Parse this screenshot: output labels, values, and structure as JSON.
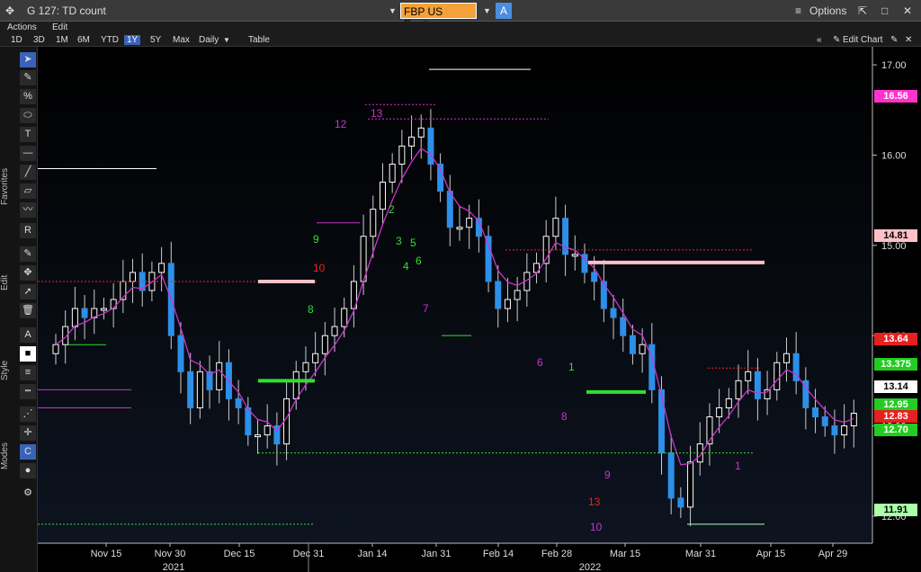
{
  "window": {
    "title": "G 127: TD count",
    "ticker": "FBP US Equity",
    "ticker_btn": "A",
    "options": "Options"
  },
  "menu": {
    "actions": "Actions",
    "edit": "Edit"
  },
  "periods": [
    "1D",
    "3D",
    "1M",
    "6M",
    "YTD",
    "1Y",
    "5Y",
    "Max"
  ],
  "period_selected": "1Y",
  "frequency": "Daily",
  "table": "Table",
  "edit_chart": "Edit Chart",
  "toolbar_sections": [
    "Favorites",
    "Edit",
    "Style",
    "Modes"
  ],
  "colors": {
    "up": "#ffffff",
    "down": "#2d8fe8",
    "td_green": "#33dd33",
    "td_magenta": "#cc33cc",
    "td_red": "#ee2222"
  },
  "chart_data": {
    "type": "candlestick",
    "ylim": [
      11.7,
      17.2
    ],
    "y_ticks": [
      "17.00",
      "16.00",
      "15.00",
      "14.00",
      "13.00",
      "12.00"
    ],
    "x_ticks": [
      "Nov 15",
      "Nov 30",
      "Dec 15",
      "Dec 31",
      "Jan 14",
      "Jan 31",
      "Feb 14",
      "Feb 28",
      "Mar 15",
      "Mar 31",
      "Apr 15",
      "Apr 29"
    ],
    "year_labels": [
      "2021",
      "2022"
    ],
    "price_labels": [
      {
        "value": "16.56",
        "color": "#ff33cc"
      },
      {
        "value": "14.81",
        "color": "#ffc0c8"
      },
      {
        "value": "13.64",
        "color": "#e62020"
      },
      {
        "value": "13.375",
        "color": "#22cc22"
      },
      {
        "value": "13.14",
        "color": "#ffffff"
      },
      {
        "value": "12.95",
        "color": "#22cc22"
      },
      {
        "value": "12.83",
        "color": "#e62020"
      },
      {
        "value": "12.70",
        "color": "#22cc22"
      },
      {
        "value": "11.91",
        "color": "#aaffaa"
      }
    ],
    "closes": [
      13.9,
      14.1,
      14.3,
      14.2,
      14.3,
      14.3,
      14.4,
      14.6,
      14.7,
      14.5,
      14.7,
      14.8,
      14.0,
      13.6,
      13.2,
      13.6,
      13.4,
      13.7,
      13.3,
      13.2,
      12.9,
      12.9,
      13.0,
      12.8,
      13.3,
      13.6,
      13.7,
      13.8,
      14.0,
      14.1,
      14.3,
      14.6,
      15.1,
      15.4,
      15.7,
      15.9,
      16.1,
      16.2,
      16.3,
      15.9,
      15.6,
      15.2,
      15.2,
      15.3,
      15.1,
      14.6,
      14.3,
      14.4,
      14.5,
      14.7,
      14.8,
      15.1,
      15.3,
      14.9,
      14.9,
      14.7,
      14.6,
      14.3,
      14.2,
      14.0,
      13.8,
      13.9,
      13.4,
      12.7,
      12.2,
      12.1,
      12.6,
      12.8,
      13.1,
      13.2,
      13.3,
      13.5,
      13.6,
      13.3,
      13.4,
      13.7,
      13.8,
      13.5,
      13.2,
      13.1,
      13.0,
      12.9,
      13.0,
      13.14
    ]
  },
  "td_counts": [
    {
      "t": "12",
      "c": "#cc33cc"
    },
    {
      "t": "13",
      "c": "#cc33cc"
    },
    {
      "t": "13",
      "c": "#ee2222"
    },
    {
      "t": "10",
      "c": "#ee2222"
    },
    {
      "t": "9",
      "c": "#33dd33"
    },
    {
      "t": "8",
      "c": "#33dd33"
    },
    {
      "t": "7",
      "c": "#cc33cc"
    },
    {
      "t": "6",
      "c": "#33dd33"
    },
    {
      "t": "1",
      "c": "#33dd33"
    },
    {
      "t": "2",
      "c": "#33dd33"
    },
    {
      "t": "3",
      "c": "#33dd33"
    },
    {
      "t": "4",
      "c": "#33dd33"
    },
    {
      "t": "5",
      "c": "#33dd33"
    },
    {
      "t": "6",
      "c": "#cc33cc"
    },
    {
      "t": "8",
      "c": "#cc33cc"
    },
    {
      "t": "9",
      "c": "#cc33cc"
    },
    {
      "t": "10",
      "c": "#cc33cc"
    },
    {
      "t": "1",
      "c": "#cc33cc"
    }
  ]
}
